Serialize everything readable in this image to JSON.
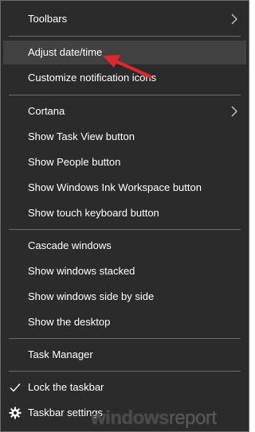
{
  "menu": {
    "items": [
      {
        "label": "Toolbars",
        "submenu": true
      },
      {
        "label": "Adjust date/time",
        "highlighted": true
      },
      {
        "label": "Customize notification icons"
      },
      {
        "label": "Cortana",
        "submenu": true
      },
      {
        "label": "Show Task View button"
      },
      {
        "label": "Show People button"
      },
      {
        "label": "Show Windows Ink Workspace button"
      },
      {
        "label": "Show touch keyboard button"
      },
      {
        "label": "Cascade windows"
      },
      {
        "label": "Show windows stacked"
      },
      {
        "label": "Show windows side by side"
      },
      {
        "label": "Show the desktop"
      },
      {
        "label": "Task Manager"
      },
      {
        "label": "Lock the taskbar",
        "icon": "checkmark-icon",
        "checked": true
      },
      {
        "label": "Taskbar settings",
        "icon": "gear-icon"
      }
    ]
  },
  "annotation": {
    "icon": "red-arrow-icon",
    "color": "#e0262a"
  },
  "watermark": {
    "brand_bold": "windows",
    "brand_light": "report"
  },
  "colors": {
    "menu_bg": "#2b2b2b",
    "hover_bg": "#414141",
    "separator": "#6b6b6b",
    "text": "#ffffff",
    "arrow": "#e0262a"
  }
}
